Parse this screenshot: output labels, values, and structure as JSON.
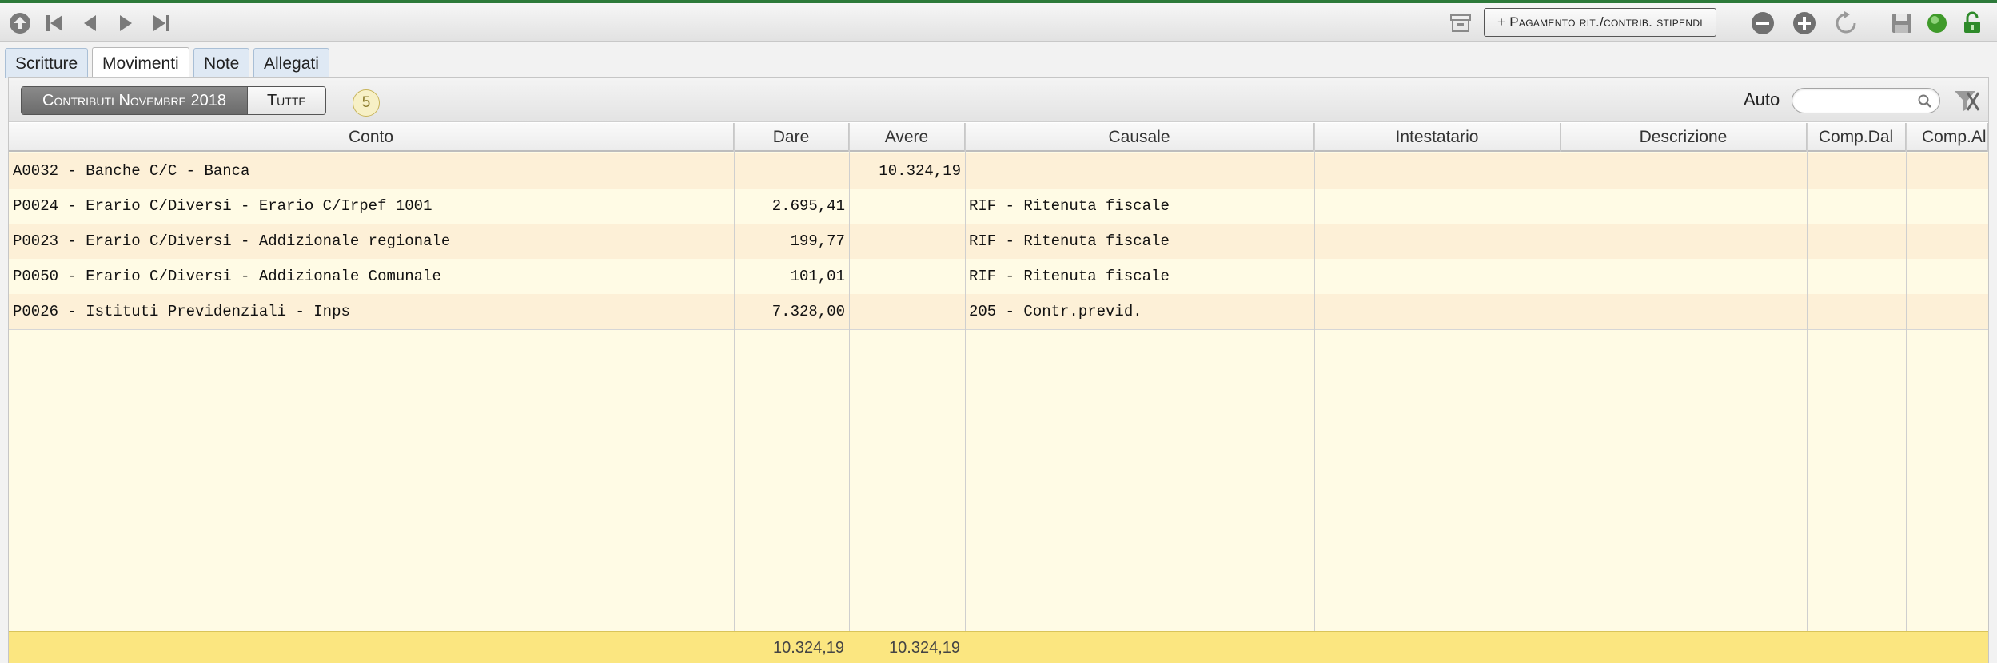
{
  "colors": {
    "accent_green": "#2d7a3a",
    "row_highlight": "#fdf0d7",
    "row_plain": "#fffbe5",
    "footer": "#fbe680",
    "tab_blue": "#dfe9f4"
  },
  "toolbar": {
    "nav_icons": [
      "home-icon",
      "first-record-icon",
      "previous-record-icon",
      "next-record-icon",
      "last-record-icon"
    ],
    "pagamento_label": "+ Pagamento rit./contrib. stipendi",
    "right_icons": [
      "archive-icon",
      "remove-icon",
      "add-icon",
      "refresh-icon",
      "save-icon",
      "status-icon",
      "unlock-icon"
    ]
  },
  "tabs": [
    {
      "label": "Scritture",
      "active": false
    },
    {
      "label": "Movimenti",
      "active": true
    },
    {
      "label": "Note",
      "active": false
    },
    {
      "label": "Allegati",
      "active": false
    }
  ],
  "filter": {
    "segment_selected": "Contributi Novembre 2018",
    "segment_other": "Tutte",
    "count": "5",
    "auto_label": "Auto",
    "search_value": ""
  },
  "table": {
    "columns": [
      "Conto",
      "Dare",
      "Avere",
      "Causale",
      "Intestatario",
      "Descrizione",
      "Comp.Dal",
      "Comp.Al"
    ],
    "rows": [
      {
        "conto": "A0032 - Banche C/C - Banca",
        "dare": "",
        "avere": "10.324,19",
        "causale": "",
        "intestatario": "",
        "descrizione": "",
        "comp_dal": "",
        "comp_al": ""
      },
      {
        "conto": "P0024 - Erario C/Diversi - Erario C/Irpef 1001",
        "dare": "2.695,41",
        "avere": "",
        "causale": "RIF - Ritenuta fiscale",
        "intestatario": "",
        "descrizione": "",
        "comp_dal": "",
        "comp_al": ""
      },
      {
        "conto": "P0023 - Erario C/Diversi - Addizionale regionale",
        "dare": "199,77",
        "avere": "",
        "causale": "RIF - Ritenuta fiscale",
        "intestatario": "",
        "descrizione": "",
        "comp_dal": "",
        "comp_al": ""
      },
      {
        "conto": "P0050 - Erario C/Diversi - Addizionale Comunale",
        "dare": "101,01",
        "avere": "",
        "causale": "RIF - Ritenuta fiscale",
        "intestatario": "",
        "descrizione": "",
        "comp_dal": "",
        "comp_al": ""
      },
      {
        "conto": "P0026 - Istituti Previdenziali - Inps",
        "dare": "7.328,00",
        "avere": "",
        "causale": "205 - Contr.previd.",
        "intestatario": "",
        "descrizione": "",
        "comp_dal": "",
        "comp_al": ""
      }
    ],
    "totals": {
      "dare": "10.324,19",
      "avere": "10.324,19"
    }
  }
}
